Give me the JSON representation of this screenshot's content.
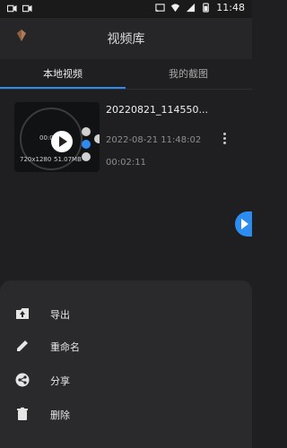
{
  "status_bar": {
    "time": "11:48"
  },
  "app_bar": {
    "title": "视频库"
  },
  "tabs": [
    {
      "label": "本地视频",
      "active": true
    },
    {
      "label": "我的截图",
      "active": false
    }
  ],
  "video": {
    "filename": "20220821_114550...",
    "datetime": "2022-08-21 11:48:02",
    "duration": "00:02:11",
    "thumb_time": "00:02:06",
    "thumb_resolution": "720x1280",
    "thumb_size": "51.07MB"
  },
  "sheet": {
    "items": [
      {
        "label": "导出",
        "icon": "export-icon"
      },
      {
        "label": "重命名",
        "icon": "rename-pencil-icon"
      },
      {
        "label": "分享",
        "icon": "share-icon"
      },
      {
        "label": "删除",
        "icon": "delete-trash-icon"
      }
    ]
  },
  "colors": {
    "accent": "#2d8cf0",
    "background": "#1f1f21",
    "sheet": "#2a2a2d"
  }
}
